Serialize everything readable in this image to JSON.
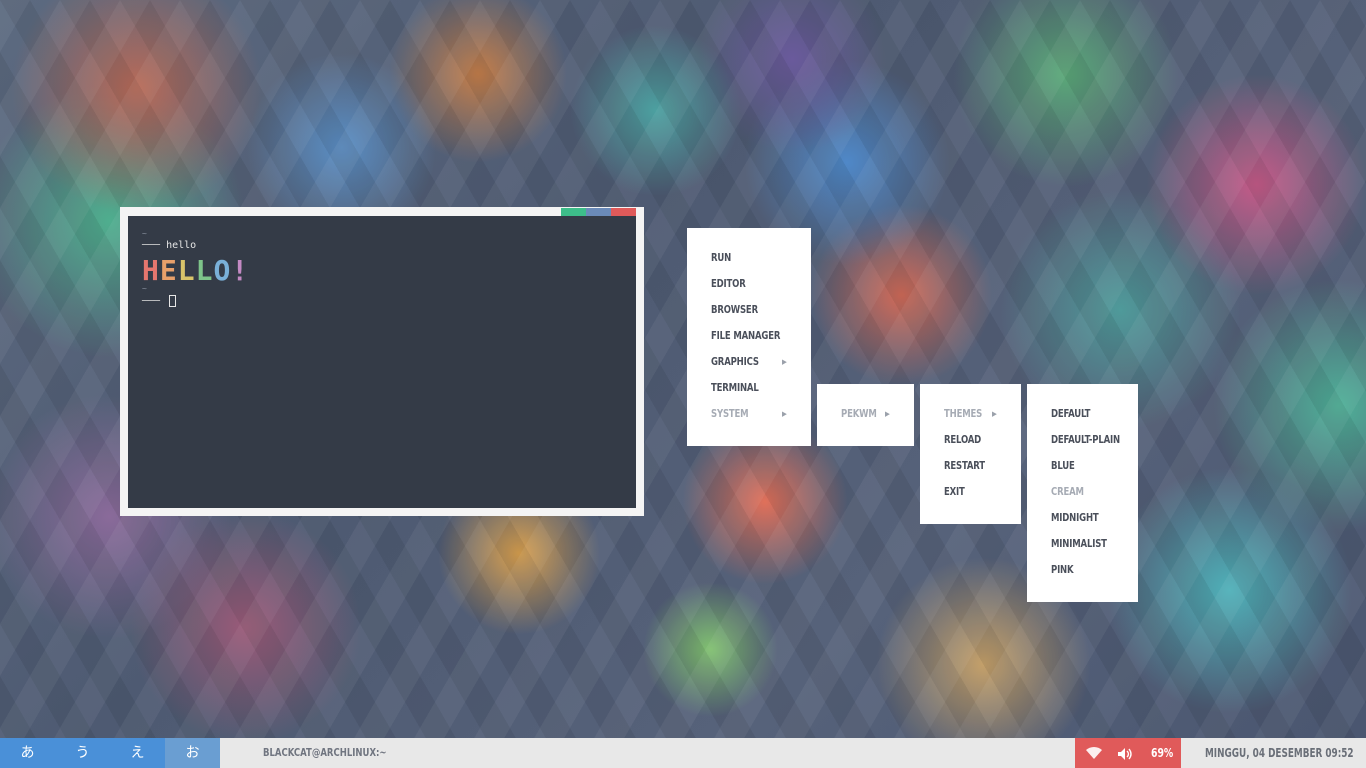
{
  "terminal": {
    "prompt_tilde": "~",
    "prompt_dash": "─── ",
    "command": "hello",
    "output_big": "HELLO!",
    "output_colors": [
      "#e5766e",
      "#e8a06a",
      "#d8c46a",
      "#7ec48a",
      "#7ab0d8",
      "#c48ac4"
    ],
    "frame_colors": {
      "green": "#3dbd8a",
      "blue": "#6a8ab8",
      "red": "#e05a5a"
    }
  },
  "menu_main": {
    "items": [
      {
        "label": "RUN",
        "disabled": false
      },
      {
        "label": "EDITOR",
        "disabled": false
      },
      {
        "label": "BROWSER",
        "disabled": false
      },
      {
        "label": "FILE MANAGER",
        "disabled": false
      },
      {
        "label": "GRAPHICS",
        "disabled": false,
        "submenu": true
      },
      {
        "label": "TERMINAL",
        "disabled": false
      },
      {
        "label": "SYSTEM",
        "disabled": true,
        "submenu": true
      }
    ]
  },
  "menu_system": {
    "items": [
      {
        "label": "PEKWM",
        "disabled": true,
        "submenu": true
      }
    ]
  },
  "menu_pekwm": {
    "items": [
      {
        "label": "THEMES",
        "disabled": true,
        "submenu": true
      },
      {
        "label": "RELOAD",
        "disabled": false
      },
      {
        "label": "RESTART",
        "disabled": false
      },
      {
        "label": "EXIT",
        "disabled": false
      }
    ]
  },
  "menu_themes": {
    "items": [
      {
        "label": "DEFAULT",
        "disabled": false
      },
      {
        "label": "DEFAULT-PLAIN",
        "disabled": false
      },
      {
        "label": "BLUE",
        "disabled": false
      },
      {
        "label": "CREAM",
        "disabled": true
      },
      {
        "label": "MIDNIGHT",
        "disabled": false
      },
      {
        "label": "MINIMALIST",
        "disabled": false
      },
      {
        "label": "PINK",
        "disabled": false
      }
    ]
  },
  "taskbar": {
    "workspaces": [
      "あ",
      "う",
      "え",
      "お"
    ],
    "active_workspace": 3,
    "window_title": "BLACKCAT@ARCHLINUX:~",
    "wifi_icon": "wifi-icon",
    "volume_icon": "volume-icon",
    "battery": "69%",
    "clock": "MINGGU, 04 DESEMBER 09:52",
    "workspace_color": "#4a90d8",
    "status_color": "#e05a5a"
  }
}
